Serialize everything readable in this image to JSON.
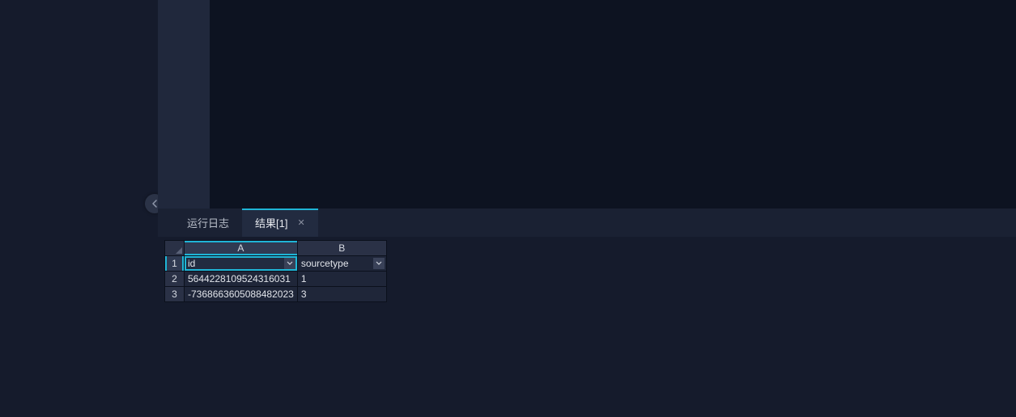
{
  "tabs": {
    "log": {
      "label": "运行日志"
    },
    "result": {
      "label": "结果[1]"
    }
  },
  "grid": {
    "columns": [
      "A",
      "B"
    ],
    "header_row": {
      "a": "id",
      "b": "sourcetype"
    },
    "rows": [
      {
        "n": "1"
      },
      {
        "n": "2",
        "a": "5644228109524316031",
        "b": "1"
      },
      {
        "n": "3",
        "a": "-7368663605088482023",
        "b": "3"
      }
    ]
  }
}
